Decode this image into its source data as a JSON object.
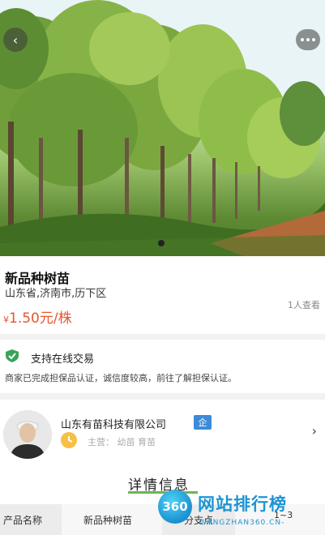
{
  "nav": {
    "back_icon": "chevron-left-icon",
    "more_icon": "more-dots-icon"
  },
  "product": {
    "title": "新品种树苗",
    "location": "山东省,济南市,历下区",
    "price_symbol": "¥",
    "price": "1.50元/株",
    "viewers": "1人查看",
    "price_color": "#e4572e"
  },
  "trade": {
    "label": "支持在线交易",
    "guarantee_text": "商家已完成担保品认证，诚信度较高，前往了解担保认证。",
    "icon": "verified-check-icon",
    "icon_color": "#3aa35a"
  },
  "merchant": {
    "company": "山东有苗科技有限公司",
    "badge": "企",
    "main_business": "主营：  幼苗 育苗",
    "chevron": "›"
  },
  "details": {
    "tab_label": "详情信息",
    "rows": [
      {
        "key": "产品名称",
        "value": "新品种树苗",
        "key2": "分支点",
        "value2": "1~3"
      }
    ]
  },
  "watermark": {
    "badge": "360",
    "text": "网站排行榜",
    "url": "WANGZHAN360.CN-"
  }
}
